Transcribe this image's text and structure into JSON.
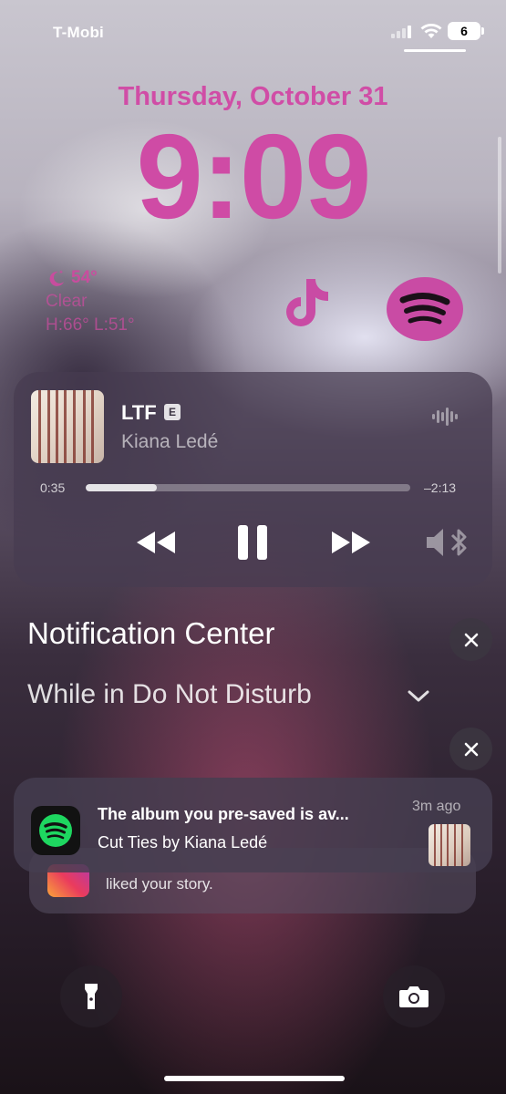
{
  "status_bar": {
    "carrier": "T-Mobi",
    "battery": "6"
  },
  "lock": {
    "date": "Thursday, October 31",
    "time": "9:09"
  },
  "weather": {
    "temp": "54°",
    "condition": "Clear",
    "range": "H:66° L:51°",
    "icon": "moon-stars-icon"
  },
  "widgets": [
    {
      "icon": "tiktok-icon"
    },
    {
      "icon": "spotify-icon"
    }
  ],
  "now_playing": {
    "title": "LTF",
    "explicit": "E",
    "artist": "Kiana Ledé",
    "elapsed": "0:35",
    "remaining": "–2:13",
    "progress": 0.22
  },
  "notification_center": {
    "title": "Notification Center",
    "filter": "While in Do Not Disturb"
  },
  "notifications": [
    {
      "app": "spotify",
      "title": "The album you pre-saved is av...",
      "body": "Cut Ties by Kiana Ledé",
      "time": "3m ago"
    },
    {
      "app": "instagram",
      "body": "liked your story."
    }
  ],
  "colors": {
    "accent": "#cf4ba5",
    "spotify_green": "#1ed760"
  }
}
